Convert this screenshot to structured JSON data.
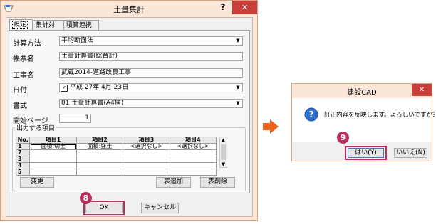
{
  "main_dialog": {
    "title": "土量集計",
    "help_button": "?",
    "close_button": "✕",
    "tabs": [
      "設定",
      "集計対象",
      "積算連携"
    ],
    "fields": {
      "calc_method": {
        "label": "計算方法",
        "value": "平均断面法"
      },
      "form_name": {
        "label": "帳票名",
        "value": "土量計算書(総合計)"
      },
      "work_name": {
        "label": "工事名",
        "value": "武蔵2014-道路改良工事"
      },
      "date": {
        "label": "日付",
        "value": "平成 27年  4月 23日",
        "checked": true
      },
      "format": {
        "label": "書式",
        "value": "01 土量計算書(A4横)"
      },
      "start_page": {
        "label": "開始ページ",
        "value": "1"
      }
    },
    "output_group": {
      "legend": "出力する項目",
      "columns": [
        "No.",
        "項目1",
        "項目2",
        "項目3",
        "項目4"
      ],
      "rows": [
        [
          "1",
          "面積:切土",
          "面積:盛土",
          "<選択なし>",
          "<選択なし>"
        ],
        [
          "2",
          "",
          "",
          "",
          ""
        ],
        [
          "3",
          "",
          "",
          "",
          ""
        ],
        [
          "4",
          "",
          "",
          "",
          ""
        ],
        [
          "5",
          "",
          "",
          "",
          ""
        ]
      ],
      "change_button": "変更",
      "add_table_button": "表追加",
      "delete_table_button": "表削除"
    },
    "ok_button": "OK",
    "cancel_button": "キャンセル",
    "step_badge": "8"
  },
  "confirm_dialog": {
    "title": "建設CAD",
    "close_button": "✕",
    "message": "訂正内容を反映します。よろしいですか？",
    "yes_button": "はい(Y)",
    "no_button": "いいえ(N)",
    "step_badge": "9"
  },
  "colors": {
    "accent": "#b5305c",
    "arrow": "#e8641e",
    "titlebar": "#fbe6d8",
    "close": "#c7403a"
  }
}
